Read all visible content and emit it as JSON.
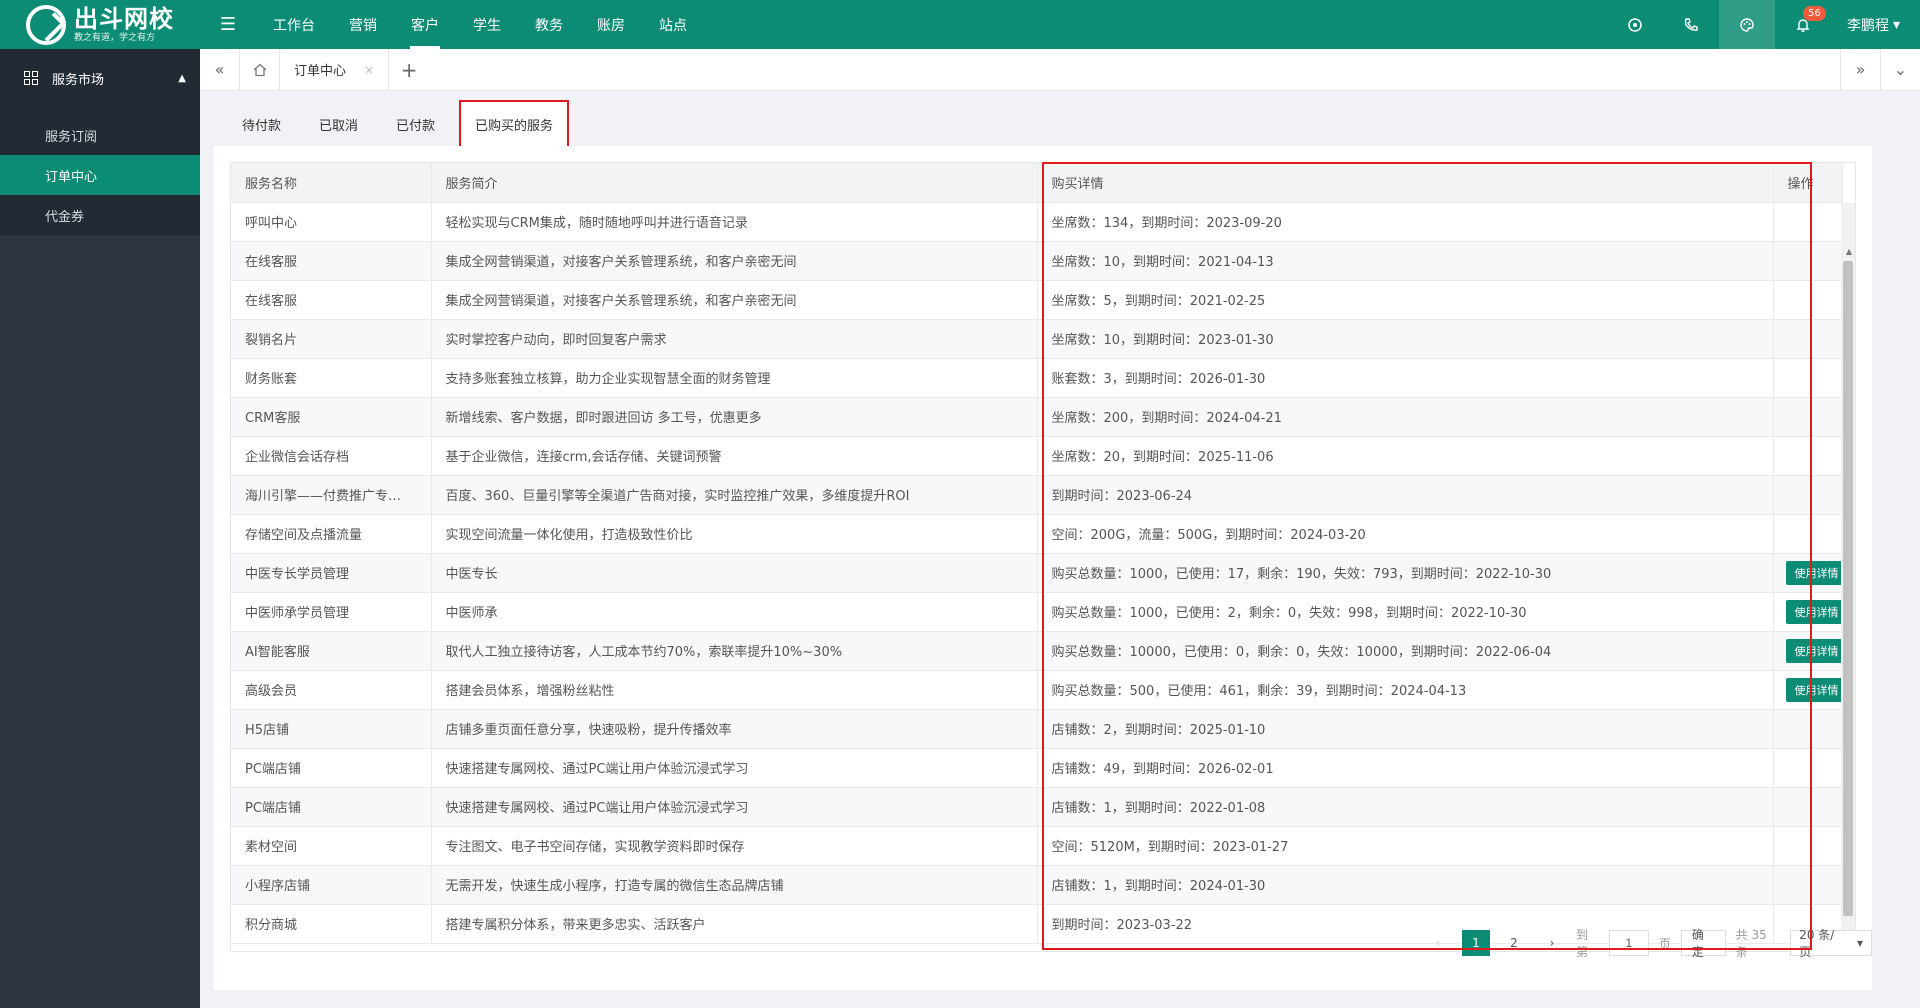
{
  "brand": {
    "title": "出斗网校",
    "slogan": "教之有道，学之有方"
  },
  "topnav": {
    "menu_icon": "menu-icon",
    "items": [
      {
        "label": "工作台"
      },
      {
        "label": "营销"
      },
      {
        "label": "客户"
      },
      {
        "label": "学生"
      },
      {
        "label": "教务"
      },
      {
        "label": "账房"
      },
      {
        "label": "站点"
      }
    ],
    "active_index": 2,
    "notification_count": "56",
    "user_name": "李鹏程"
  },
  "sidebar": {
    "header": "服务市场",
    "items": [
      {
        "label": "服务订阅"
      },
      {
        "label": "订单中心"
      },
      {
        "label": "代金券"
      }
    ],
    "active_index": 1
  },
  "tabstrip": {
    "current_tab": "订单中心",
    "close": "×",
    "add": "+"
  },
  "subtabs": {
    "items": [
      "待付款",
      "已取消",
      "已付款",
      "已购买的服务"
    ],
    "active_index": 3
  },
  "table": {
    "headers": [
      "服务名称",
      "服务简介",
      "购买详情",
      "操作"
    ],
    "action_label": "使用详情",
    "rows": [
      {
        "name": "呼叫中心",
        "desc": "轻松实现与CRM集成，随时随地呼叫并进行语音记录",
        "detail": "坐席数：134，到期时间：2023-09-20",
        "action": false
      },
      {
        "name": "在线客服",
        "desc": "集成全网营销渠道，对接客户关系管理系统，和客户亲密无间",
        "detail": "坐席数：10，到期时间：2021-04-13",
        "action": false
      },
      {
        "name": "在线客服",
        "desc": "集成全网营销渠道，对接客户关系管理系统，和客户亲密无间",
        "detail": "坐席数：5，到期时间：2021-02-25",
        "action": false
      },
      {
        "name": "裂销名片",
        "desc": "实时掌控客户动向，即时回复客户需求",
        "detail": "坐席数：10，到期时间：2023-01-30",
        "action": false
      },
      {
        "name": "财务账套",
        "desc": "支持多账套独立核算，助力企业实现智慧全面的财务管理",
        "detail": "账套数：3，到期时间：2026-01-30",
        "action": false
      },
      {
        "name": "CRM客服",
        "desc": "新增线索、客户数据，即时跟进回访 多工号，优惠更多",
        "detail": "坐席数：200，到期时间：2024-04-21",
        "action": false
      },
      {
        "name": "企业微信会话存档",
        "desc": "基于企业微信，连接crm,会话存储、关键词预警",
        "detail": "坐席数：20，到期时间：2025-11-06",
        "action": false
      },
      {
        "name": "海川引擎——付费推广专…",
        "desc": "百度、360、巨量引擎等全渠道广告商对接，实时监控推广效果，多维度提升ROI",
        "detail": "到期时间：2023-06-24",
        "action": false
      },
      {
        "name": "存储空间及点播流量",
        "desc": "实现空间流量一体化使用，打造极致性价比",
        "detail": "空间：200G，流量：500G，到期时间：2024-03-20",
        "action": false
      },
      {
        "name": "中医专长学员管理",
        "desc": "中医专长",
        "detail": "购买总数量：1000，已使用：17，剩余：190，失效：793，到期时间：2022-10-30",
        "action": true
      },
      {
        "name": "中医师承学员管理",
        "desc": "中医师承",
        "detail": "购买总数量：1000，已使用：2，剩余：0，失效：998，到期时间：2022-10-30",
        "action": true
      },
      {
        "name": "AI智能客服",
        "desc": "取代人工独立接待访客，人工成本节约70%，索联率提升10%~30%",
        "detail": "购买总数量：10000，已使用：0，剩余：0，失效：10000，到期时间：2022-06-04",
        "action": true
      },
      {
        "name": "高级会员",
        "desc": "搭建会员体系，增强粉丝粘性",
        "detail": "购买总数量：500，已使用：461，剩余：39，到期时间：2024-04-13",
        "action": true
      },
      {
        "name": "H5店铺",
        "desc": "店铺多重页面任意分享，快速吸粉，提升传播效率",
        "detail": "店铺数：2，到期时间：2025-01-10",
        "action": false
      },
      {
        "name": "PC端店铺",
        "desc": "快速搭建专属网校、通过PC端让用户体验沉浸式学习",
        "detail": "店铺数：49，到期时间：2026-02-01",
        "action": false
      },
      {
        "name": "PC端店铺",
        "desc": "快速搭建专属网校、通过PC端让用户体验沉浸式学习",
        "detail": "店铺数：1，到期时间：2022-01-08",
        "action": false
      },
      {
        "name": "素材空间",
        "desc": "专注图文、电子书空间存储，实现教学资料即时保存",
        "detail": "空间：5120M，到期时间：2023-01-27",
        "action": false
      },
      {
        "name": "小程序店铺",
        "desc": "无需开发，快速生成小程序，打造专属的微信生态品牌店铺",
        "detail": "店铺数：1，到期时间：2024-01-30",
        "action": false
      },
      {
        "name": "积分商城",
        "desc": "搭建专属积分体系，带来更多忠实、活跃客户",
        "detail": "到期时间：2023-03-22",
        "action": false
      }
    ]
  },
  "pagination": {
    "prev": "‹",
    "pages": [
      "1",
      "2"
    ],
    "active_page": "1",
    "next": "›",
    "goto_label": "到第",
    "goto_value": "1",
    "page_unit": "页",
    "confirm": "确定",
    "total": "共 35 条",
    "page_size": "20 条/页"
  }
}
